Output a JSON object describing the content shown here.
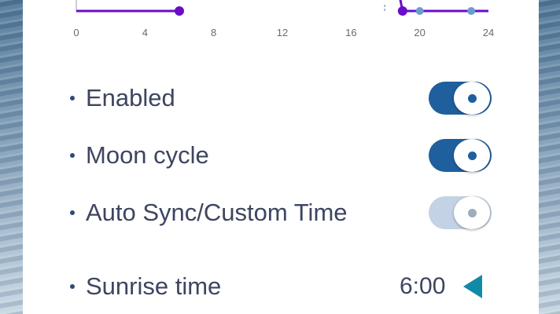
{
  "chart": {
    "x_ticks": [
      "0",
      "4",
      "8",
      "12",
      "16",
      "20",
      "24"
    ],
    "line_color": "#6a0dc8",
    "point_color": "#6d9ccf"
  },
  "chart_data": {
    "type": "line",
    "xlim": [
      0,
      24
    ],
    "series": [
      {
        "values": [
          [
            0,
            0
          ],
          [
            6,
            0
          ]
        ]
      },
      {
        "values": [
          [
            18.6,
            1
          ],
          [
            19,
            0
          ],
          [
            20,
            0
          ],
          [
            23,
            0
          ],
          [
            24,
            0
          ]
        ]
      }
    ],
    "tick_labels": [
      "0",
      "4",
      "8",
      "12",
      "16",
      "20",
      "24"
    ]
  },
  "settings": {
    "enabled": {
      "label": "Enabled",
      "on": true
    },
    "moon_cycle": {
      "label": "Moon cycle",
      "on": true
    },
    "auto_sync": {
      "label": "Auto Sync/Custom Time",
      "on": false
    },
    "sunrise": {
      "label": "Sunrise time",
      "value": "6:00",
      "arrow": "triangle-left-icon"
    }
  },
  "colors": {
    "toggle_on": "#1f5f9e",
    "toggle_off": "#c3d2e4",
    "accent_arrow": "#118aa8"
  }
}
